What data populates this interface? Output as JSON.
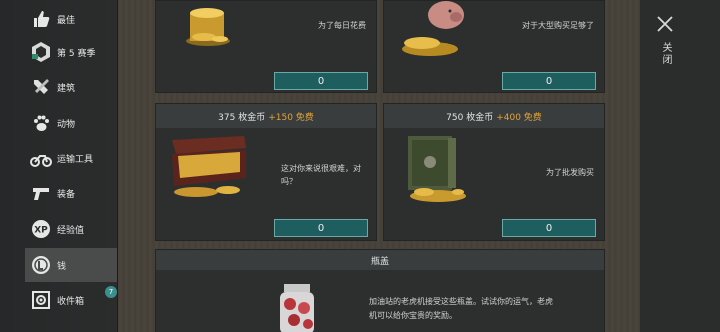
{
  "sidebar": {
    "items": [
      {
        "label": "最佳",
        "icon": "thumbs-up-icon"
      },
      {
        "label": "第 5 赛季",
        "icon": "season-badge-icon"
      },
      {
        "label": "建筑",
        "icon": "build-tools-icon"
      },
      {
        "label": "动物",
        "icon": "paw-icon"
      },
      {
        "label": "运输工具",
        "icon": "motorcycle-icon"
      },
      {
        "label": "装备",
        "icon": "gun-icon"
      },
      {
        "label": "经验值",
        "icon": "xp-icon"
      },
      {
        "label": "钱",
        "icon": "coin-icon"
      },
      {
        "label": "收件箱",
        "icon": "inbox-icon"
      }
    ],
    "inbox_badge": "7",
    "active_index": 7
  },
  "offers": [
    {
      "title": "",
      "bonus": "",
      "desc": "为了每日花费",
      "price": "0"
    },
    {
      "title": "",
      "bonus": "",
      "desc": "对于大型购买足够了",
      "price": "0"
    },
    {
      "title": "375 枚金币",
      "bonus": "+150 免费",
      "desc": "这对你来说很艰难，对吗？",
      "price": "0"
    },
    {
      "title": "750 枚金币",
      "bonus": "+400 免费",
      "desc": "为了批发购买",
      "price": "0"
    }
  ],
  "bottle_cap": {
    "title": "瓶盖",
    "desc": "加油站的老虎机接受这些瓶盖。试试你的运气，老虎机可以给你宝贵的奖励。"
  },
  "close_label": "关闭",
  "colors": {
    "bonus": "#e3a23a",
    "button": "#1f5e5f",
    "button_border": "#6aa9a6",
    "badge": "#3b8f8c"
  }
}
